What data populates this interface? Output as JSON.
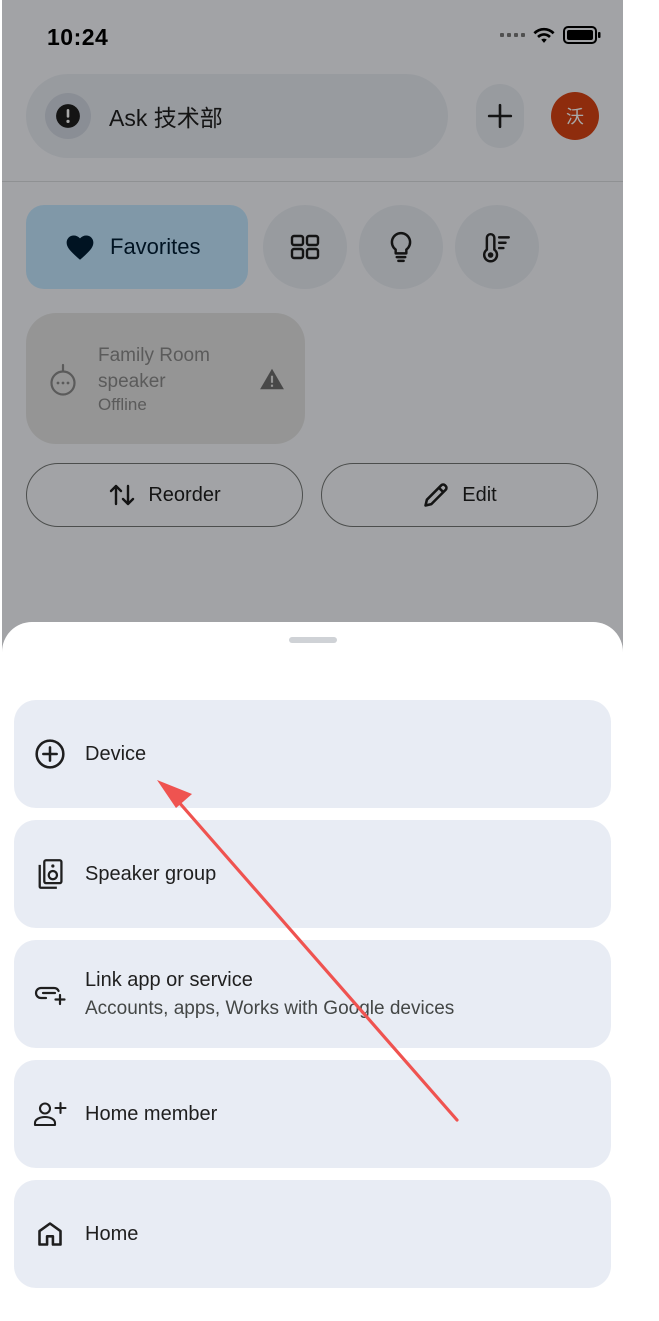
{
  "status_bar": {
    "time": "10:24"
  },
  "header": {
    "ask_label": "Ask 技术部",
    "avatar_initial": "沃",
    "avatar_color": "#d84315"
  },
  "filters": {
    "favorites_label": "Favorites",
    "accent_color": "#c2e7ff",
    "icons": [
      "grid-icon",
      "lightbulb-icon",
      "thermostat-icon"
    ]
  },
  "device_card": {
    "name": "Family Room speaker",
    "status": "Offline"
  },
  "actions": {
    "reorder_label": "Reorder",
    "edit_label": "Edit"
  },
  "sheet": {
    "items": [
      {
        "icon": "add-circle-icon",
        "title": "Device",
        "subtitle": ""
      },
      {
        "icon": "speaker-group-icon",
        "title": "Speaker group",
        "subtitle": ""
      },
      {
        "icon": "link-add-icon",
        "title": "Link app or service",
        "subtitle": "Accounts, apps, Works with Google devices"
      },
      {
        "icon": "person-add-icon",
        "title": "Home member",
        "subtitle": ""
      },
      {
        "icon": "home-icon",
        "title": "Home",
        "subtitle": ""
      }
    ]
  },
  "annotation": {
    "color": "#ef5350",
    "target": "Device"
  }
}
